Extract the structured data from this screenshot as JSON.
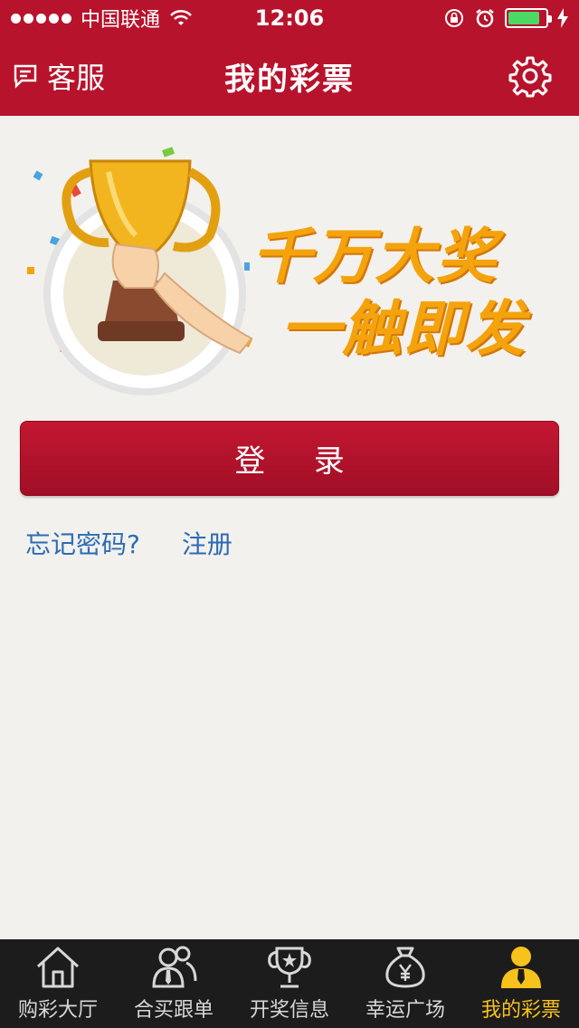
{
  "status_bar": {
    "carrier": "中国联通",
    "time": "12:06",
    "battery_level": 0.85
  },
  "nav": {
    "left_label": "客服",
    "title": "我的彩票",
    "left_icon": "customer-service-icon",
    "right_icon": "gear-icon"
  },
  "hero": {
    "slogan_line1": "千万大奖",
    "slogan_line2": "一触即发",
    "image": "trophy-illustration"
  },
  "login": {
    "button_label": "登 录",
    "forgot_password": "忘记密码?",
    "register": "注册"
  },
  "tabs": [
    {
      "label": "购彩大厅",
      "icon": "house-icon",
      "active": false
    },
    {
      "label": "合买跟单",
      "icon": "users-icon",
      "active": false
    },
    {
      "label": "开奖信息",
      "icon": "trophy-icon",
      "active": false
    },
    {
      "label": "幸运广场",
      "icon": "money-bag-icon",
      "active": false
    },
    {
      "label": "我的彩票",
      "icon": "user-icon",
      "active": true
    }
  ],
  "colors": {
    "brand_red": "#b8132c",
    "link_blue": "#2b6cb5",
    "active_tab": "#f7c21c",
    "slogan_gold": "#f5a30c"
  }
}
